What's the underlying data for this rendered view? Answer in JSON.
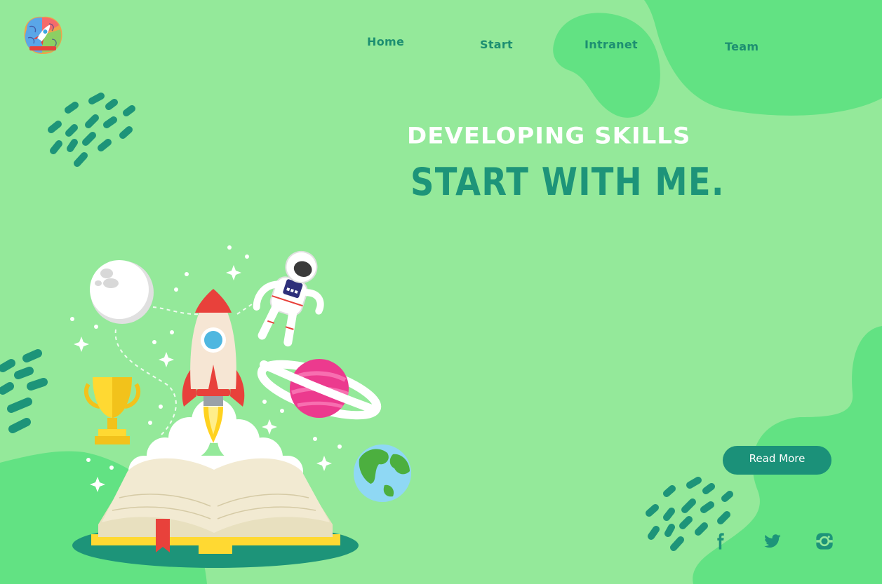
{
  "nav": {
    "home": "Home",
    "start": "Start",
    "intranet": "Intranet",
    "team": "Team"
  },
  "hero": {
    "subtitle": "DEVELOPING SKILLS",
    "title": "START WITH ME."
  },
  "cta": {
    "read_more": "Read More"
  },
  "social": [
    "facebook-icon",
    "twitter-icon",
    "instagram-icon"
  ],
  "colors": {
    "background": "#94e99a",
    "blob": "#62e283",
    "accent": "#1b9179",
    "text_white": "#ffffff"
  }
}
